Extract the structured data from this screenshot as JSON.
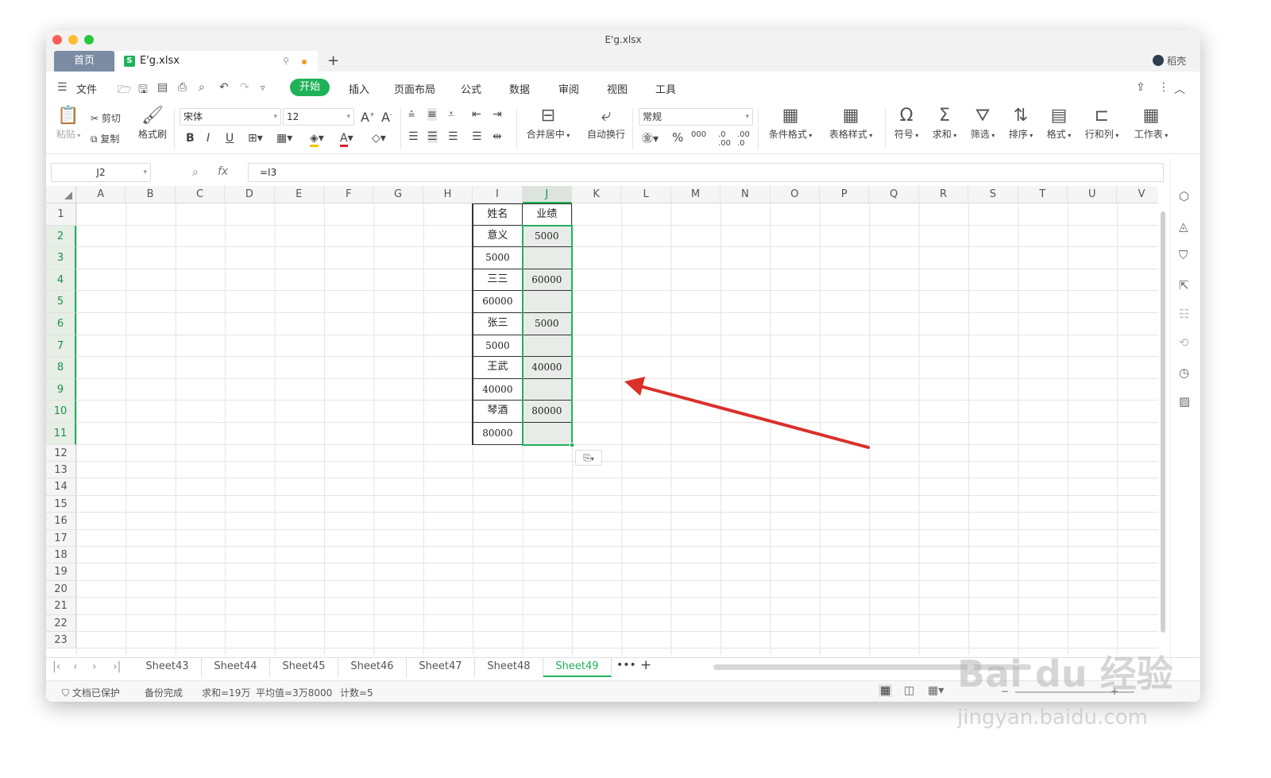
{
  "window": {
    "title": "E'g.xlsx"
  },
  "tabs": {
    "home": "首页",
    "file": "E'g.xlsx"
  },
  "user": {
    "name": "稻壳"
  },
  "menu": {
    "file": "文件",
    "items": [
      "开始",
      "插入",
      "页面布局",
      "公式",
      "数据",
      "审阅",
      "视图",
      "工具"
    ]
  },
  "ribbon": {
    "paste": "粘贴",
    "cut": "剪切",
    "copy": "复制",
    "format_painter": "格式刷",
    "font": "宋体",
    "size": "12",
    "merge": "合并居中",
    "wrap": "自动换行",
    "number_format": "常规",
    "cond_format": "条件格式",
    "table_style": "表格样式",
    "symbol": "符号",
    "sum": "求和",
    "filter": "筛选",
    "sort": "排序",
    "format": "格式",
    "rowcol": "行和列",
    "sheet": "工作表"
  },
  "formula_bar": {
    "cell": "J2",
    "fx": "fx",
    "formula": "=I3"
  },
  "columns": [
    "A",
    "B",
    "C",
    "D",
    "E",
    "F",
    "G",
    "H",
    "I",
    "J",
    "K",
    "L",
    "M",
    "N",
    "O",
    "P",
    "Q",
    "R",
    "S",
    "T",
    "U",
    "V"
  ],
  "selected_column": "J",
  "rows": [
    "1",
    "2",
    "3",
    "4",
    "5",
    "6",
    "7",
    "8",
    "9",
    "10",
    "11",
    "12",
    "13",
    "14",
    "15",
    "16",
    "17",
    "18",
    "19",
    "20",
    "21",
    "22",
    "23"
  ],
  "table": {
    "I": [
      "姓名",
      "意义",
      "5000",
      "三三",
      "60000",
      "张三",
      "5000",
      "王武",
      "40000",
      "琴酒",
      "80000"
    ],
    "J": [
      "业绩",
      "5000",
      "",
      "60000",
      "",
      "5000",
      "",
      "40000",
      "",
      "80000",
      ""
    ]
  },
  "sheets": [
    "Sheet43",
    "Sheet44",
    "Sheet45",
    "Sheet46",
    "Sheet47",
    "Sheet48",
    "Sheet49"
  ],
  "active_sheet": "Sheet49",
  "status": {
    "protect": "文档已保护",
    "backup": "备份完成",
    "sum": "求和=19万",
    "avg": "平均值=3万8000",
    "count": "计数=5"
  },
  "watermark": {
    "brand": "Bai du 经验",
    "url": "jingyan.baidu.com"
  },
  "colors": {
    "accent": "#1fb25a",
    "arrow": "#d9302a"
  }
}
